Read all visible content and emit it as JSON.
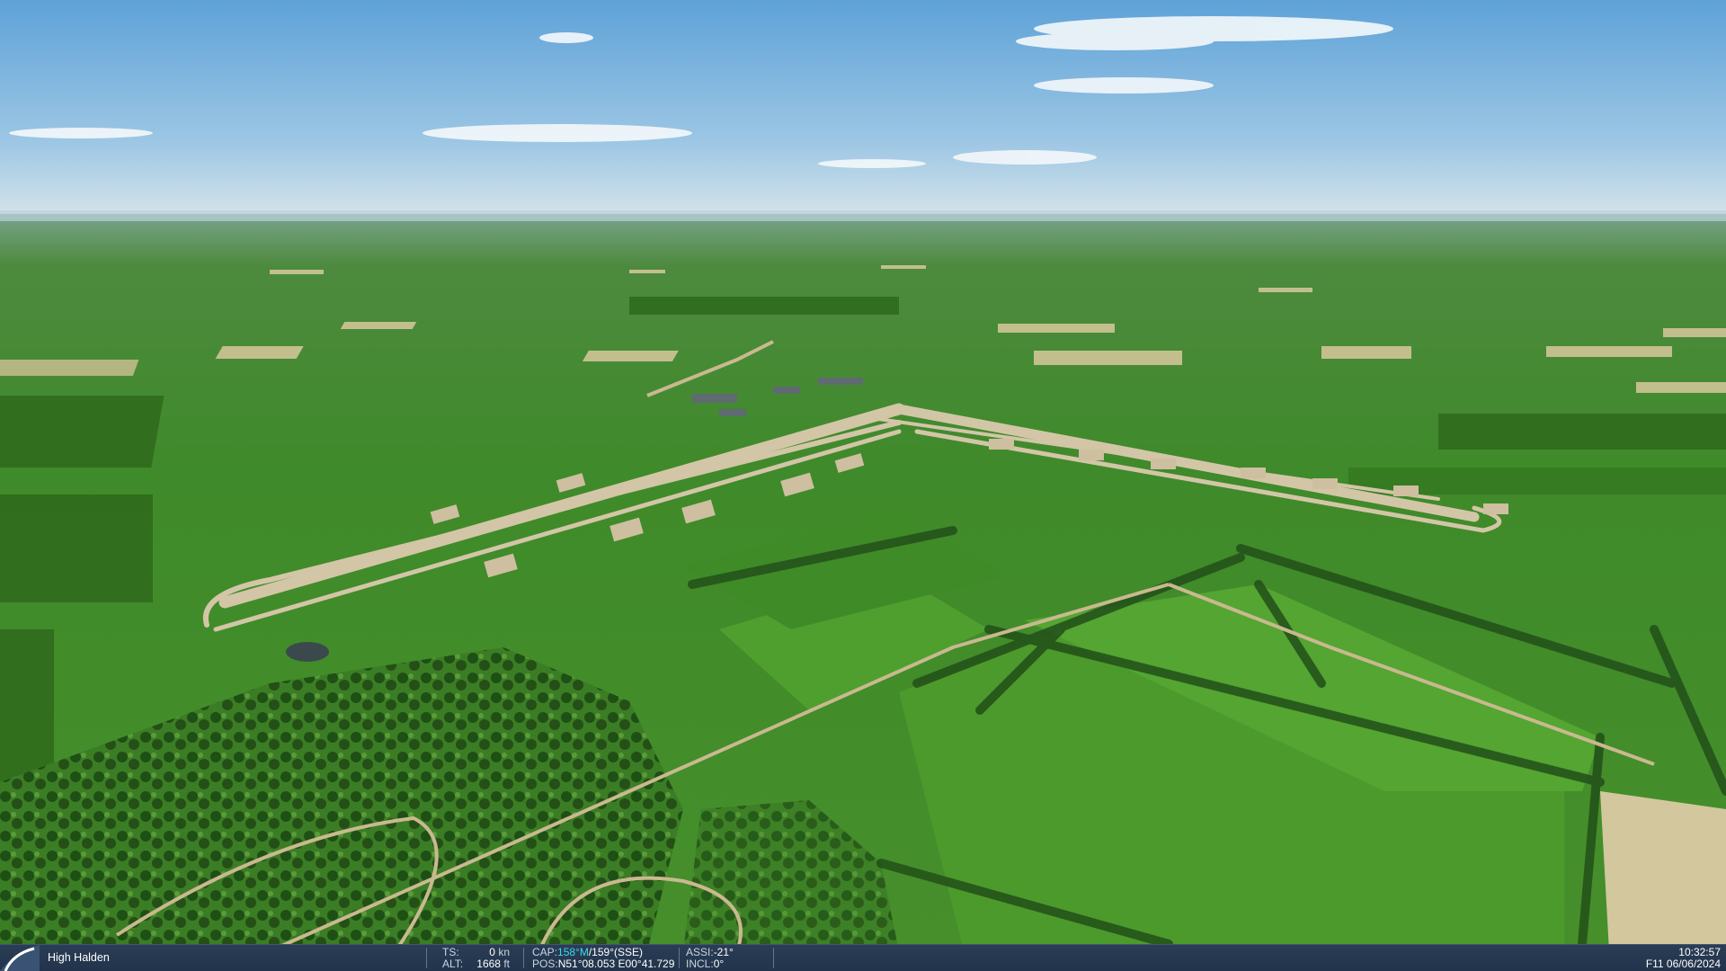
{
  "scene": {
    "description_icon": "aerial-view",
    "colors": {
      "sky_top": "#5aa0d6",
      "sky_horizon": "#c9dbe6",
      "field_green": "#4f9a2e",
      "dark_green": "#2f6a1c",
      "tarmac": "#cbbfa3"
    }
  },
  "statusbar": {
    "place": "High Halden",
    "ts_label": "TS:",
    "ts_value": "0",
    "ts_unit": "kn",
    "alt_label": "ALT:",
    "alt_value": "1668",
    "alt_unit": "ft",
    "cap_label": "CAP:",
    "cap_magnetic": "158°M",
    "cap_true": "/159°(SSE)",
    "pos_label": "POS:",
    "pos_value": "N51°08.053 E00°41.729",
    "assi_label": "ASSI:",
    "assi_value": "-21°",
    "incl_label": "INCL:",
    "incl_value": "0°",
    "time": "10:32:57",
    "date": "F11 06/06/2024"
  }
}
